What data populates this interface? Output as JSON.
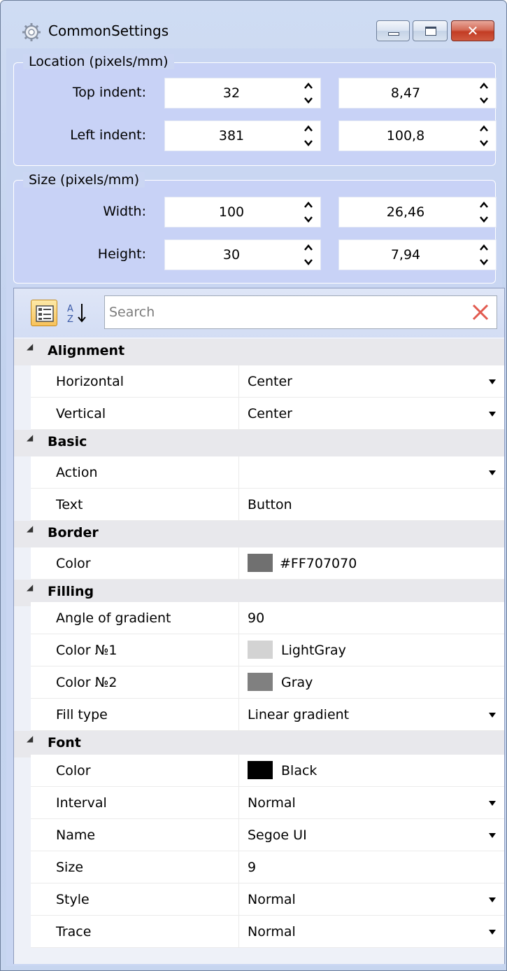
{
  "window": {
    "title": "CommonSettings",
    "icon": "gear-icon",
    "caption_buttons": [
      "minimize",
      "maximize",
      "close"
    ]
  },
  "location": {
    "legend": "Location (pixels/mm)",
    "rows": [
      {
        "label": "Top indent:",
        "pixels": "32",
        "mm": "8,47"
      },
      {
        "label": "Left indent:",
        "pixels": "381",
        "mm": "100,8"
      }
    ]
  },
  "size": {
    "legend": "Size (pixels/mm)",
    "rows": [
      {
        "label": "Width:",
        "pixels": "100",
        "mm": "26,46"
      },
      {
        "label": "Height:",
        "pixels": "30",
        "mm": "7,94"
      }
    ]
  },
  "toolbar": {
    "categorized_icon": "categorized-view-icon",
    "alphabetical_icon": "sort-az-icon",
    "search_placeholder": "Search",
    "clear_icon": "clear-x-icon"
  },
  "colors": {
    "border_color": "#707070",
    "fill_color1": "#d3d3d3",
    "fill_color2": "#808080",
    "font_color": "#000000",
    "clear_x": "#e25a4f",
    "accent": "#c9d6f2"
  },
  "categories": [
    {
      "name": "Alignment",
      "props": [
        {
          "name": "Horizontal",
          "value": "Center",
          "dropdown": true
        },
        {
          "name": "Vertical",
          "value": "Center",
          "dropdown": true
        }
      ]
    },
    {
      "name": "Basic",
      "props": [
        {
          "name": "Action",
          "value": "",
          "dropdown": true
        },
        {
          "name": "Text",
          "value": "Button",
          "dropdown": false
        }
      ]
    },
    {
      "name": "Border",
      "props": [
        {
          "name": "Color",
          "value": "#FF707070",
          "dropdown": false
        }
      ]
    },
    {
      "name": "Filling",
      "props": [
        {
          "name": "Angle of gradient",
          "value": "90",
          "dropdown": false
        },
        {
          "name": "Color №1",
          "value": "LightGray",
          "dropdown": false
        },
        {
          "name": "Color №2",
          "value": "Gray",
          "dropdown": false
        },
        {
          "name": "Fill type",
          "value": "Linear gradient",
          "dropdown": true
        }
      ]
    },
    {
      "name": "Font",
      "props": [
        {
          "name": "Color",
          "value": "Black",
          "dropdown": false
        },
        {
          "name": "Interval",
          "value": "Normal",
          "dropdown": true
        },
        {
          "name": "Name",
          "value": "Segoe UI",
          "dropdown": true
        },
        {
          "name": "Size",
          "value": "9",
          "dropdown": false
        },
        {
          "name": "Style",
          "value": "Normal",
          "dropdown": true
        },
        {
          "name": "Trace",
          "value": "Normal",
          "dropdown": true
        }
      ]
    }
  ]
}
